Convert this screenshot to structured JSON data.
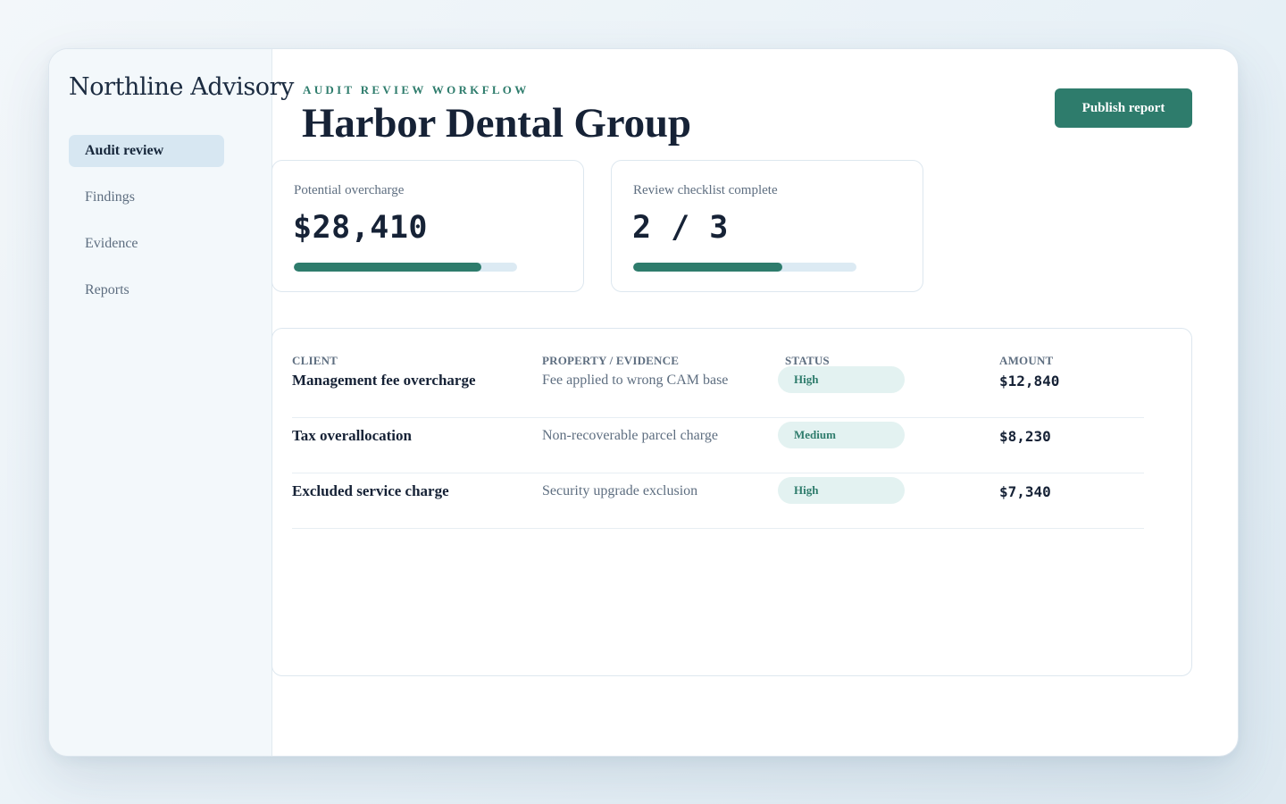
{
  "sidebar": {
    "brand": "Northline Advisory",
    "items": [
      {
        "label": "Audit review",
        "active": true
      },
      {
        "label": "Findings",
        "active": false
      },
      {
        "label": "Evidence",
        "active": false
      },
      {
        "label": "Reports",
        "active": false
      }
    ]
  },
  "header": {
    "eyebrow": "AUDIT REVIEW WORKFLOW",
    "title": "Harbor Dental Group",
    "publish_label": "Publish report"
  },
  "stats": [
    {
      "label": "Potential overcharge",
      "value": "$28,410",
      "progress": 0.84
    },
    {
      "label": "Review checklist complete",
      "value": "2 / 3",
      "progress": 0.667
    }
  ],
  "table": {
    "headers": {
      "client": "CLIENT",
      "evidence": "PROPERTY / EVIDENCE",
      "status": "STATUS",
      "amount": "AMOUNT"
    },
    "rows": [
      {
        "client": "Management fee overcharge",
        "evidence": "Fee applied to wrong CAM base",
        "status": "High",
        "amount": "$12,840"
      },
      {
        "client": "Tax overallocation",
        "evidence": "Non-recoverable parcel charge",
        "status": "Medium",
        "amount": "$8,230"
      },
      {
        "client": "Excluded service charge",
        "evidence": "Security upgrade exclusion",
        "status": "High",
        "amount": "$7,340"
      }
    ]
  },
  "colors": {
    "accent": "#2e7c6c",
    "nav_active_bg": "#d7e7f2",
    "pill_bg": "#e3f2f1",
    "track": "#dceaf3"
  }
}
